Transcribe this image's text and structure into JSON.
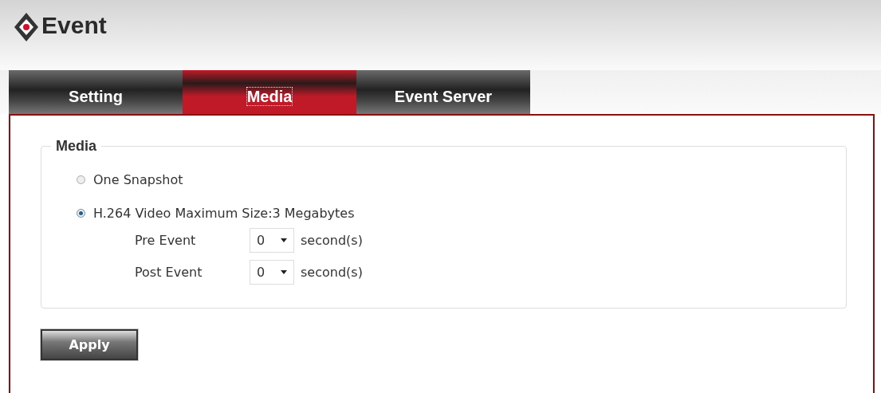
{
  "header": {
    "title": "Event"
  },
  "tabs": [
    {
      "label": "Setting",
      "selected": false
    },
    {
      "label": "Media",
      "selected": true
    },
    {
      "label": "Event Server",
      "selected": false
    }
  ],
  "media": {
    "legend": "Media",
    "options": [
      {
        "label": "One Snapshot",
        "selected": false
      },
      {
        "label": "H.264 Video Maximum Size:3 Megabytes",
        "selected": true
      }
    ],
    "timings": [
      {
        "label": "Pre Event",
        "value": "0",
        "unit": "second(s)"
      },
      {
        "label": "Post Event",
        "value": "0",
        "unit": "second(s)"
      }
    ]
  },
  "apply_button": "Apply"
}
